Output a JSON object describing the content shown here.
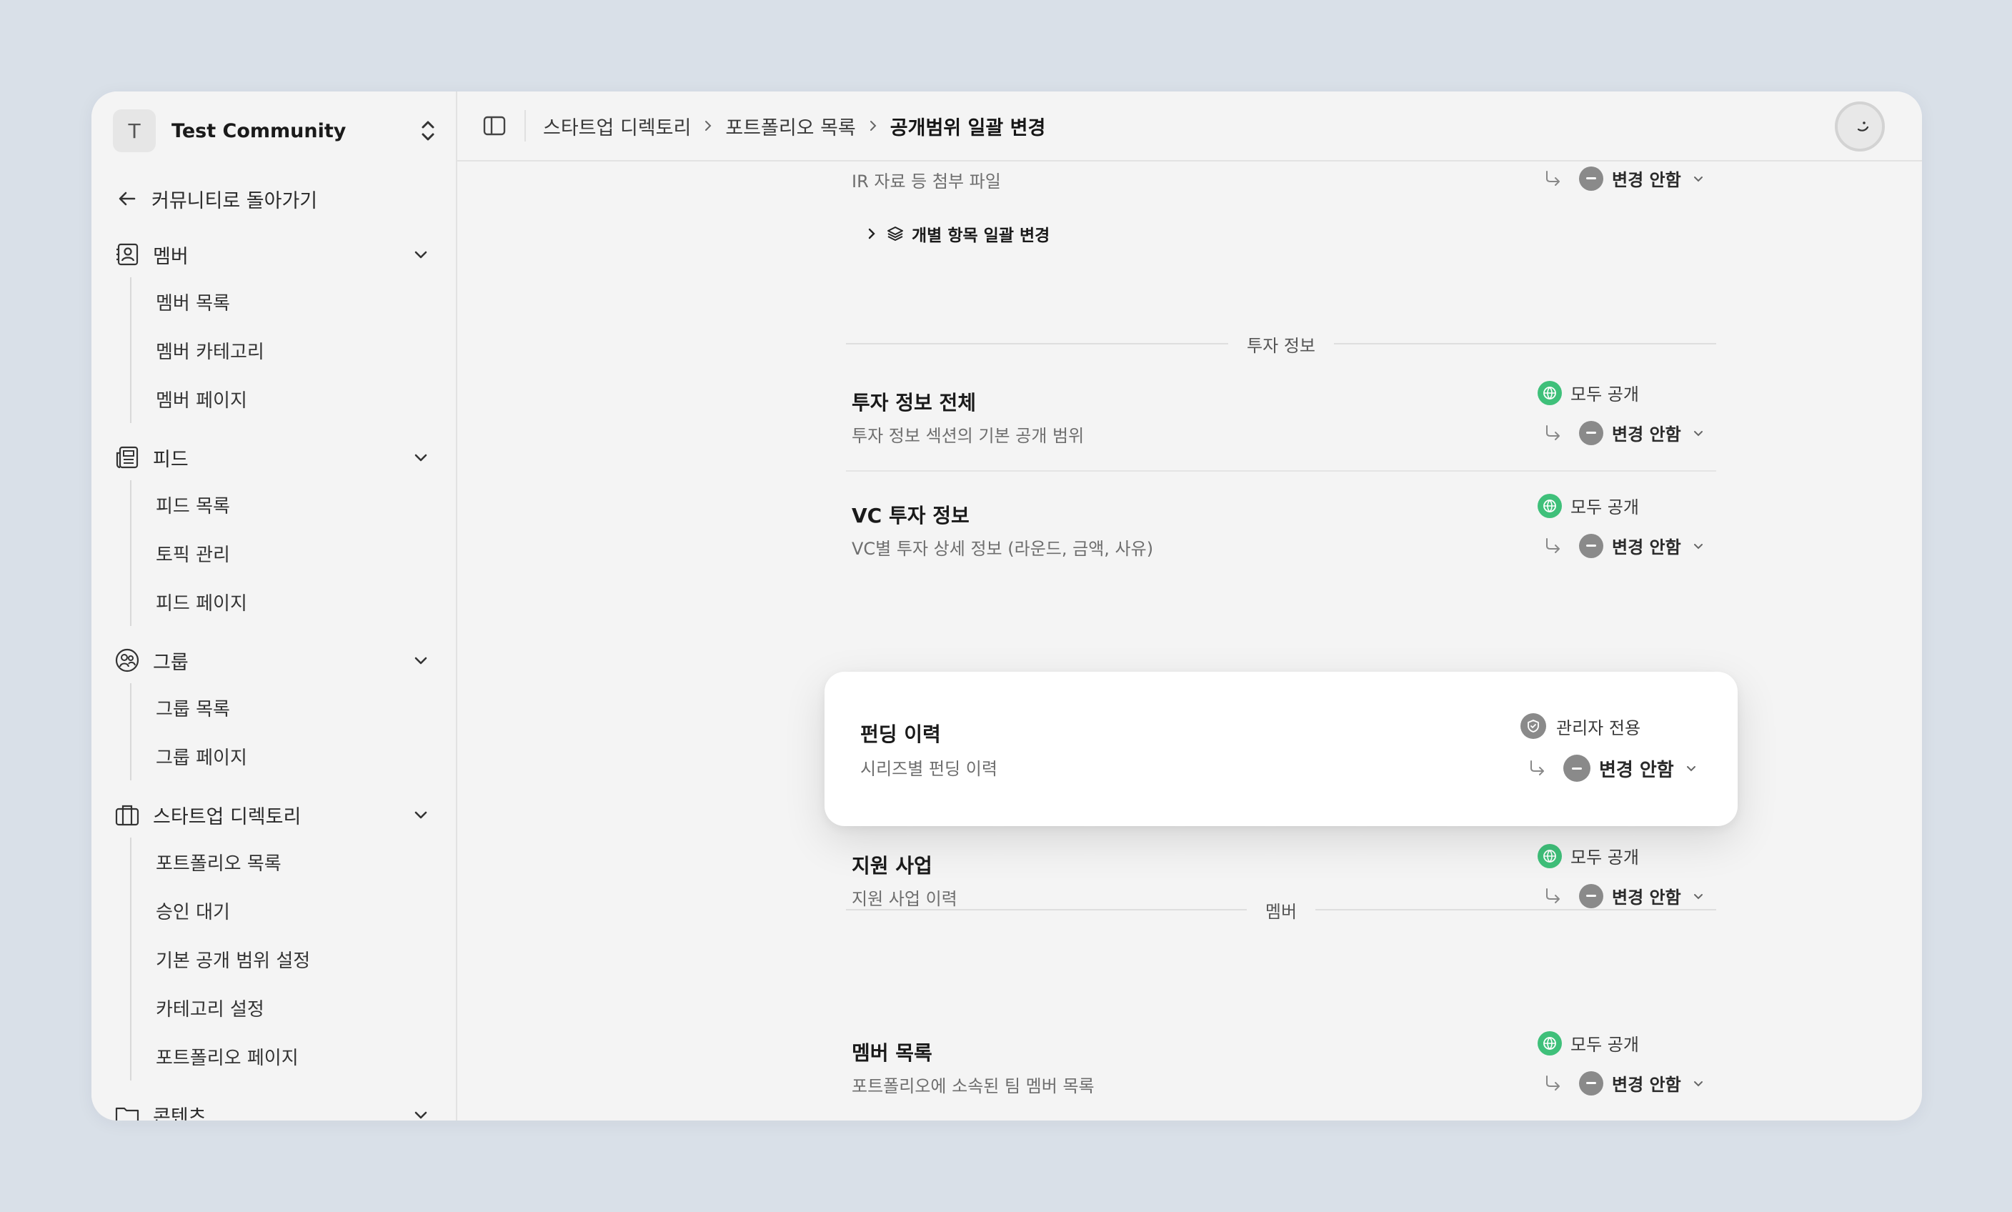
{
  "community": {
    "initial": "T",
    "name": "Test Community"
  },
  "sidebar": {
    "back_label": "커뮤니티로 돌아가기",
    "sections": [
      {
        "label": "멤버",
        "icon": "member-card-icon",
        "items": [
          "멤버 목록",
          "멤버 카테고리",
          "멤버 페이지"
        ]
      },
      {
        "label": "피드",
        "icon": "newspaper-icon",
        "items": [
          "피드 목록",
          "토픽 관리",
          "피드 페이지"
        ]
      },
      {
        "label": "그룹",
        "icon": "group-icon",
        "items": [
          "그룹 목록",
          "그룹 페이지"
        ]
      },
      {
        "label": "스타트업 디렉토리",
        "icon": "briefcase-icon",
        "items": [
          "포트폴리오 목록",
          "승인 대기",
          "기본 공개 범위 설정",
          "카테고리 설정",
          "포트폴리오 페이지"
        ]
      },
      {
        "label": "콘텐츠",
        "icon": "folder-icon",
        "items": []
      }
    ]
  },
  "breadcrumb": [
    "스타트업 디렉토리",
    "포트폴리오 목록",
    "공개범위 일괄 변경"
  ],
  "content": {
    "top_row": {
      "subtitle": "IR 자료 등 첨부 파일",
      "change_label": "변경 안함"
    },
    "bulk_label": "개별 항목 일괄 변경",
    "section_invest": "투자 정보",
    "section_member": "멤버",
    "rows": [
      {
        "title": "투자 정보 전체",
        "subtitle": "투자 정보 섹션의 기본 공개 범위",
        "visibility": "모두 공개",
        "change_label": "변경 안함"
      },
      {
        "title": "VC 투자 정보",
        "subtitle": "VC별 투자 상세 정보 (라운드, 금액, 사유)",
        "visibility": "모두 공개",
        "change_label": "변경 안함"
      },
      {
        "title": "펀딩 이력",
        "subtitle": "시리즈별 펀딩 이력",
        "visibility": "관리자 전용",
        "change_label": "변경 안함"
      },
      {
        "title": "지원 사업",
        "subtitle": "지원 사업 이력",
        "visibility": "모두 공개",
        "change_label": "변경 안함"
      },
      {
        "title": "멤버 목록",
        "subtitle": "포트폴리오에 소속된 팀 멤버 목록",
        "visibility": "모두 공개",
        "change_label": "변경 안함"
      }
    ]
  },
  "colors": {
    "public_green": "#3fc07a",
    "admin_gray": "#8a8a8a",
    "background": "#d9e0e8"
  }
}
